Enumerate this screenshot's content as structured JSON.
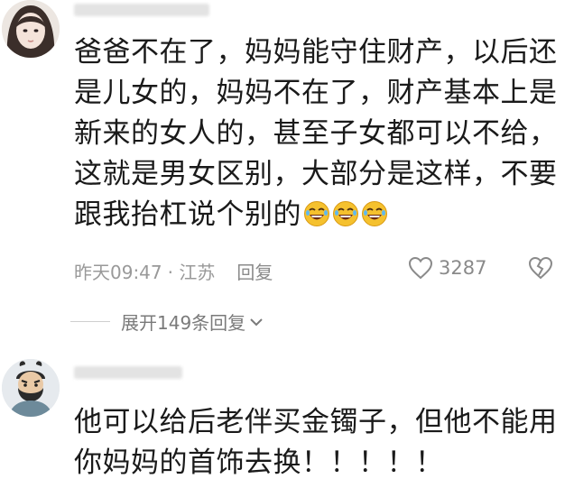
{
  "comments": [
    {
      "text": "爸爸不在了，妈妈能守住财产，以后还是儿女的，妈妈不在了，财产基本上是新来的女人的，甚至子女都可以不给，这就是男女区别，大部分是这样，不要跟我抬杠说个别的",
      "emoji_icons": [
        "rofl-emoji-icon",
        "rofl-emoji-icon",
        "rofl-emoji-icon"
      ],
      "time": "昨天09:47",
      "location": "· 江苏",
      "reply_label": "回复",
      "like_count": "3287",
      "expand_label": "展开149条回复"
    },
    {
      "text": "他可以给后老伴买金镯子，但他不能用你妈妈的首饰去换！！！！！"
    }
  ],
  "colors": {
    "text": "#1a1a1a",
    "meta": "#999999",
    "emoji": "#f5c12e"
  }
}
